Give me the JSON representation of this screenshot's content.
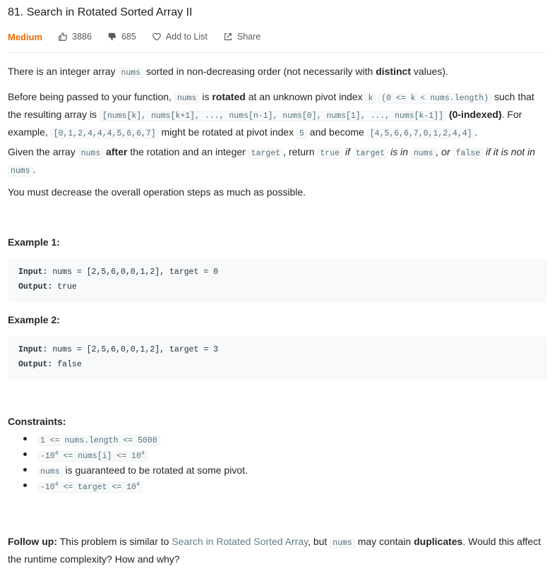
{
  "problem": {
    "title": "81. Search in Rotated Sorted Array II",
    "difficulty": "Medium",
    "likes": "3886",
    "dislikes": "685",
    "add_to_list": "Add to List",
    "share": "Share"
  },
  "description": {
    "p1": {
      "t1": "There is an integer array",
      "c1": "nums",
      "t2": "sorted in non-decreasing order (not necessarily with",
      "b1": "distinct",
      "t3": "values)."
    },
    "p2": {
      "t1": "Before being passed to your function,",
      "c1": "nums",
      "t2": "is",
      "b1": "rotated",
      "t3": "at an unknown pivot index",
      "c2": "k",
      "c3": "(0 <= k < nums.length)",
      "t4": "such that the resulting array is",
      "c4": "[nums[k], nums[k+1], ..., nums[n-1], nums[0], nums[1], ..., nums[k-1]]",
      "b2": "(0-indexed)",
      "t5": ". For example,",
      "c5": "[0,1,2,4,4,4,5,6,6,7]",
      "t6": "might be rotated at pivot index",
      "c6": "5",
      "t7": "and become",
      "c7": "[4,5,6,6,7,0,1,2,4,4]",
      "t8": "."
    },
    "p3": {
      "t1": "Given the array",
      "c1": "nums",
      "b1": "after",
      "t2": "the rotation and an integer",
      "c2": "target",
      "t3": ", return",
      "c3": "true",
      "i1": "if",
      "c4": "target",
      "i2": "is in",
      "c5": "nums",
      "i3": ", or",
      "c6": "false",
      "i4": "if it is not in",
      "c7": "nums",
      "t4": "."
    },
    "p4": "You must decrease the overall operation steps as much as possible."
  },
  "examples": [
    {
      "title": "Example 1:",
      "input_label": "Input:",
      "input": "nums = [2,5,6,0,0,1,2], target = 0",
      "output_label": "Output:",
      "output": "true"
    },
    {
      "title": "Example 2:",
      "input_label": "Input:",
      "input": "nums = [2,5,6,0,0,1,2], target = 3",
      "output_label": "Output:",
      "output": "false"
    }
  ],
  "constraints": {
    "title": "Constraints:",
    "c1": "1 <= nums.length <= 5000",
    "c2a": "-10",
    "c2b": "4",
    "c2c": "<= nums[i] <= 10",
    "c2d": "4",
    "c3a": "nums",
    "c3b": "is guaranteed to be rotated at some pivot.",
    "c4a": "-10",
    "c4b": "4",
    "c4c": "<= target <= 10",
    "c4d": "4"
  },
  "followup": {
    "label": "Follow up:",
    "t1": "This problem is similar to",
    "link": "Search in Rotated Sorted Array",
    "t2": ", but",
    "c1": "nums",
    "t3": "may contain",
    "b1": "duplicates",
    "t4": ". Would this affect the runtime complexity? How and why?"
  },
  "colors": {
    "difficulty_medium": "#ef6c00",
    "code_text": "#546e7a",
    "code_bg": "#f7f9fa",
    "link": "#607d8b"
  }
}
